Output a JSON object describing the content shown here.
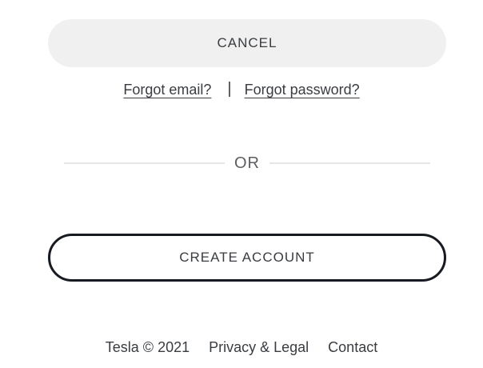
{
  "buttons": {
    "cancel_label": "CANCEL",
    "create_account_label": "CREATE ACCOUNT"
  },
  "forgot": {
    "email_label": "Forgot email?",
    "separator": "|",
    "password_label": "Forgot password?"
  },
  "divider": {
    "label": "OR"
  },
  "footer": {
    "copyright": "Tesla © 2021",
    "privacy_label": "Privacy & Legal",
    "contact_label": "Contact"
  },
  "colors": {
    "text": "#393c41",
    "cancel_bg": "#f0f0f0",
    "create_border": "#171a20",
    "divider_line": "#e6e6e6"
  }
}
